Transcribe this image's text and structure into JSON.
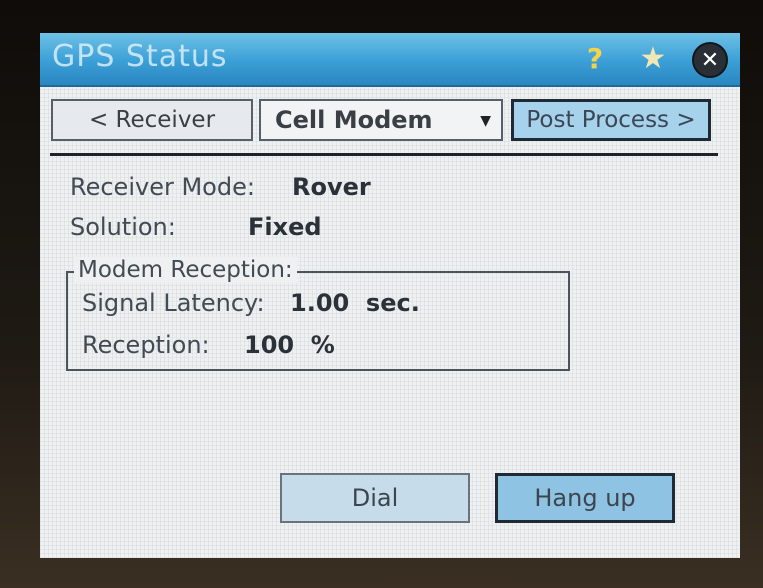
{
  "window": {
    "title": "GPS Status",
    "icons": [
      "help-icon",
      "star-icon",
      "close-icon"
    ],
    "accent": "#3a9fd6"
  },
  "nav": {
    "receiver_label": "< Receiver",
    "mode_select_value": "Cell Modem",
    "post_process_label": "Post Process >"
  },
  "status": {
    "receiver_mode_label": "Receiver Mode:",
    "receiver_mode_value": "Rover",
    "solution_label": "Solution:",
    "solution_value": "Fixed"
  },
  "modem": {
    "group_label": "Modem Reception:",
    "latency_label": "Signal Latency:",
    "latency_value": "1.00  sec.",
    "reception_label": "Reception:",
    "reception_value": "100  %"
  },
  "actions": {
    "dial_label": "Dial",
    "hangup_label": "Hang up"
  }
}
